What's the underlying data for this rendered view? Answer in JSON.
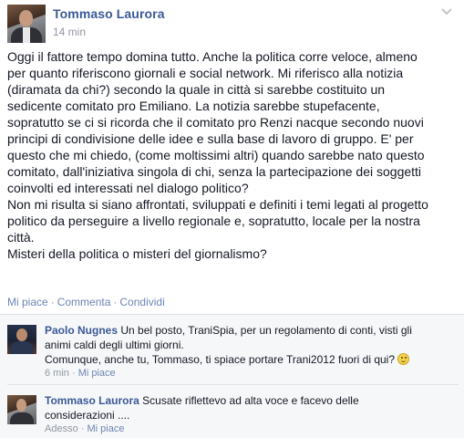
{
  "post": {
    "author": "Tommaso Laurora",
    "time": "14 min",
    "body": "Oggi il fattore tempo domina tutto. Anche la politica corre veloce, almeno\nper quanto riferiscono giornali e social network. Mi riferisco alla notizia\n(diramata da chi?) secondo la quale in città si sarebbe costituito un\nsedicente comitato pro Emiliano. La notizia sarebbe stupefacente,\nsopratutto se ci si ricorda che il comitato pro Renzi nacque secondo nuovi\nprincipi di condivisione delle idee e sulla base di lavoro di gruppo. E' per\nquesto che mi chiedo, (come moltissimi altri) quando sarebbe nato questo\ncomitato, dall'iniziativa singola di chi, senza la partecipazione dei soggetti\ncoinvolti ed interessati nel dialogo politico?\nNon mi risulta si siano affrontati, sviluppati e definiti i temi legati al progetto\npolitico da perseguire a livello regionale e, sopratutto, locale per la nostra\ncittà.\nMisteri della politica o misteri del giornalismo?",
    "actions": {
      "like": "Mi piace",
      "comment": "Commenta",
      "share": "Condividi",
      "separator": "·"
    },
    "menu_icon": "chevron-down-icon"
  },
  "comments": [
    {
      "author": "Paolo Nugnes",
      "text_line1": "Un bel posto, TraniSpia, per un regolamento di conti, visti gli",
      "text_line2": "animi caldi degli ultimi giorni.",
      "text_line3": "Comunque, anche tu, Tommaso, ti spiace portare Trani2012 fuori di qui?",
      "emoji": "smiley-icon",
      "time": "6 min",
      "like": "Mi piace"
    },
    {
      "author": "Tommaso Laurora",
      "text_line1": "Scusate riflettevo ad alta voce e facevo delle",
      "text_line2": "considerazioni ....",
      "time": "Adesso",
      "like": "Mi piace"
    }
  ],
  "colors": {
    "link": "#3b5998",
    "muted": "#9197a3",
    "comments_bg": "#f6f7f8"
  }
}
